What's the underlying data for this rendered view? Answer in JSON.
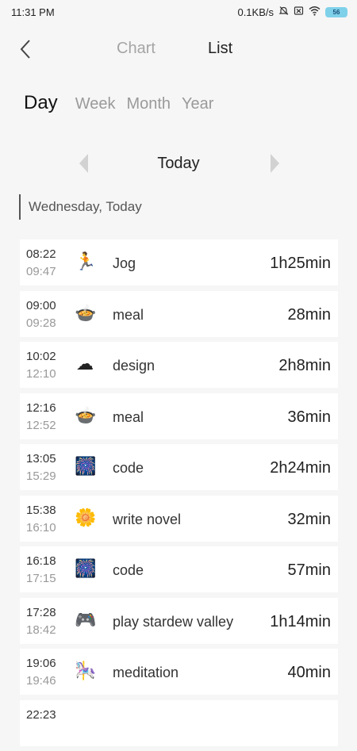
{
  "status_bar": {
    "time": "11:31 PM",
    "network_speed": "0.1KB/s",
    "icons": [
      "bell-off-icon",
      "sim-x-icon",
      "wifi-icon"
    ],
    "battery": "56"
  },
  "header": {
    "back_icon": "chevron-left-icon",
    "tabs": [
      "Chart",
      "List"
    ],
    "active_tab": "List"
  },
  "period_tabs": {
    "items": [
      "Day",
      "Week",
      "Month",
      "Year"
    ],
    "active": "Day"
  },
  "date_nav": {
    "label": "Today"
  },
  "section": {
    "header": "Wednesday, Today"
  },
  "entries": [
    {
      "start": "08:22",
      "end": "09:47",
      "icon": "running-person-icon",
      "name": "Jog",
      "duration": "1h25min"
    },
    {
      "start": "09:00",
      "end": "09:28",
      "icon": "bowl-icon",
      "name": "meal",
      "duration": "28min"
    },
    {
      "start": "10:02",
      "end": "12:10",
      "icon": "cloud-icon",
      "name": "design",
      "duration": "2h8min"
    },
    {
      "start": "12:16",
      "end": "12:52",
      "icon": "bowl-icon",
      "name": "meal",
      "duration": "36min"
    },
    {
      "start": "13:05",
      "end": "15:29",
      "icon": "fireworks-icon",
      "name": "code",
      "duration": "2h24min"
    },
    {
      "start": "15:38",
      "end": "16:10",
      "icon": "flower-icon",
      "name": "write novel",
      "duration": "32min"
    },
    {
      "start": "16:18",
      "end": "17:15",
      "icon": "fireworks-icon",
      "name": "code",
      "duration": "57min"
    },
    {
      "start": "17:28",
      "end": "18:42",
      "icon": "gamepad-icon",
      "name": "play stardew valley",
      "duration": "1h14min"
    },
    {
      "start": "19:06",
      "end": "19:46",
      "icon": "carousel-horse-icon",
      "name": "meditation",
      "duration": "40min"
    },
    {
      "start": "22:23",
      "end": "",
      "icon": "",
      "name": "",
      "duration": ""
    }
  ]
}
